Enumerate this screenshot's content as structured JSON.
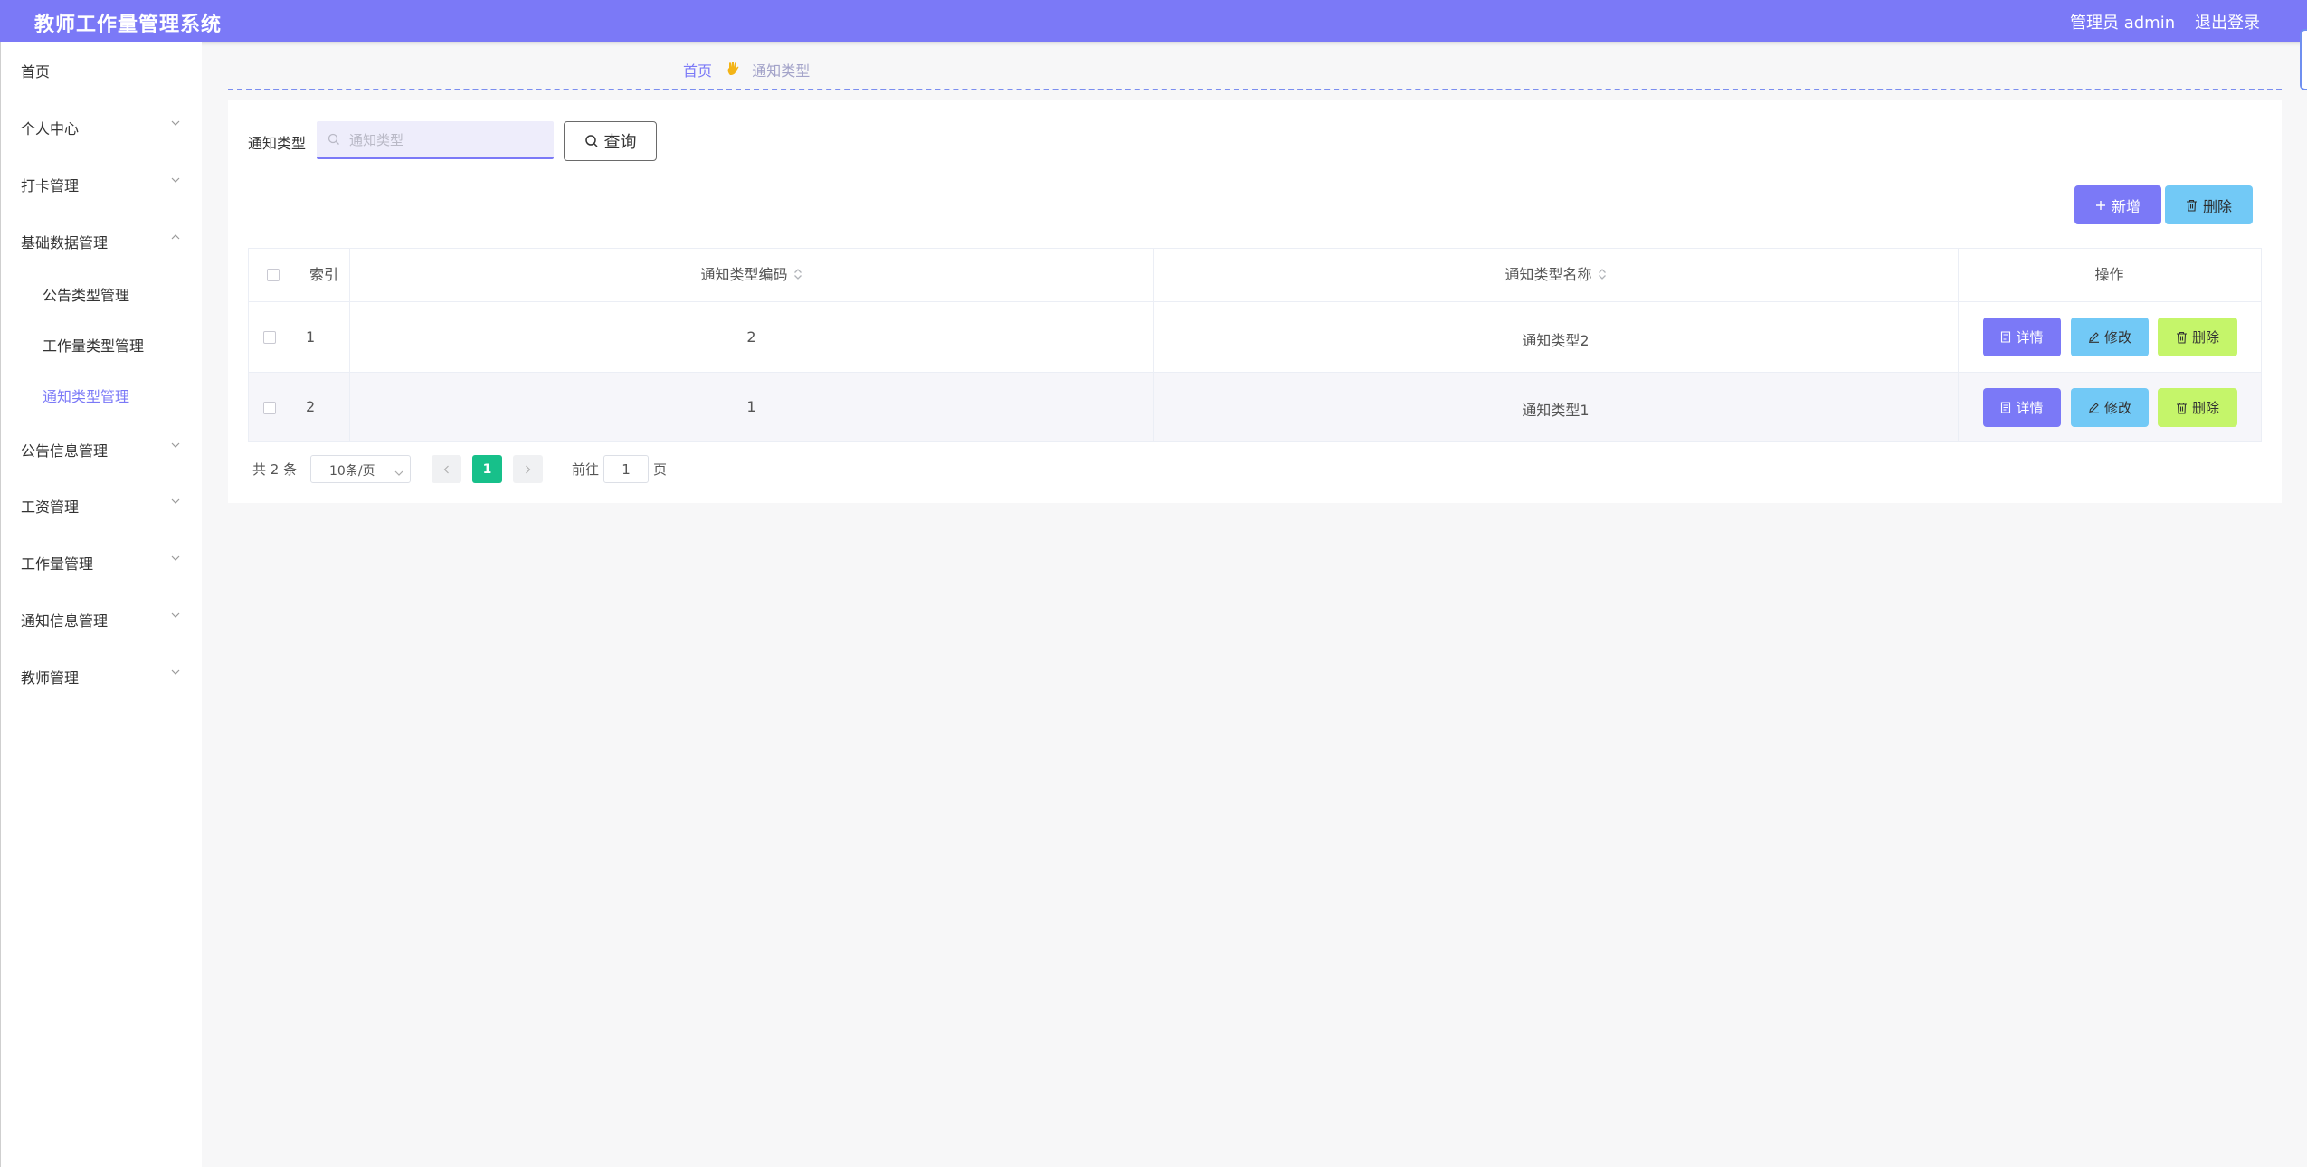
{
  "header": {
    "title": "教师工作量管理系统",
    "user": "管理员 admin",
    "logout": "退出登录",
    "color": "#7b79f7"
  },
  "sidebar": {
    "items": [
      {
        "label": "首页",
        "expandable": false
      },
      {
        "label": "个人中心",
        "expandable": true,
        "expanded": false
      },
      {
        "label": "打卡管理",
        "expandable": true,
        "expanded": false
      },
      {
        "label": "基础数据管理",
        "expandable": true,
        "expanded": true
      },
      {
        "label": "公告信息管理",
        "expandable": true,
        "expanded": false
      },
      {
        "label": "工资管理",
        "expandable": true,
        "expanded": false
      },
      {
        "label": "工作量管理",
        "expandable": true,
        "expanded": false
      },
      {
        "label": "通知信息管理",
        "expandable": true,
        "expanded": false
      },
      {
        "label": "教师管理",
        "expandable": true,
        "expanded": false
      }
    ],
    "subitems": [
      {
        "label": "公告类型管理",
        "active": false
      },
      {
        "label": "工作量类型管理",
        "active": false
      },
      {
        "label": "通知类型管理",
        "active": true
      }
    ]
  },
  "breadcrumb": {
    "home": "首页",
    "current": "通知类型"
  },
  "search": {
    "label": "通知类型",
    "placeholder": "通知类型",
    "value": "",
    "button": "查询"
  },
  "actions": {
    "add": "新增",
    "delete": "删除"
  },
  "table": {
    "columns": [
      "索引",
      "通知类型编码",
      "通知类型名称",
      "操作"
    ],
    "rows": [
      {
        "index": "1",
        "code": "2",
        "name": "通知类型2"
      },
      {
        "index": "2",
        "code": "1",
        "name": "通知类型1"
      }
    ],
    "ops": {
      "detail": "详情",
      "edit": "修改",
      "delete": "删除"
    }
  },
  "pagination": {
    "total": "共 2 条",
    "page_size": "10条/页",
    "current_page": "1",
    "goto_label": "前往",
    "goto_value": "1",
    "page_suffix": "页"
  }
}
